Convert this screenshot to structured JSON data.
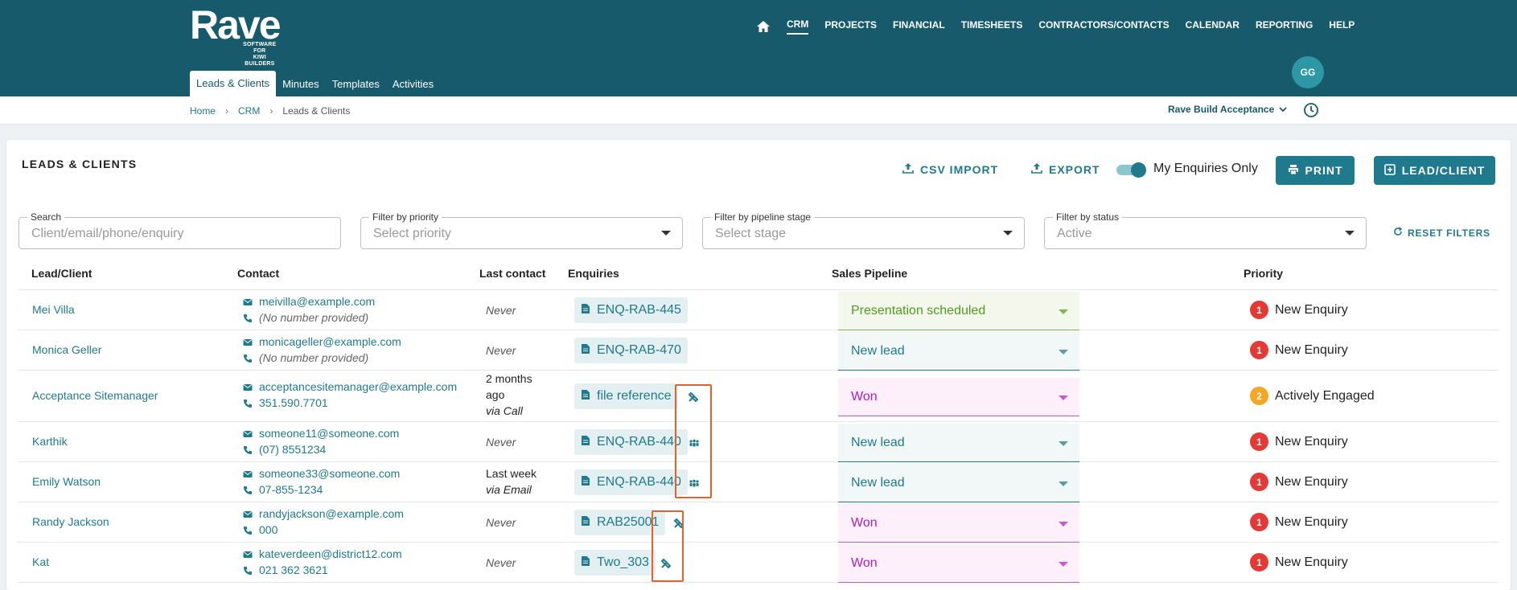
{
  "app": {
    "logo_text": "Rave",
    "logo_sub": "SOFTWARE FOR\nKIWI BUILDERS"
  },
  "main_nav": [
    "CRM",
    "PROJECTS",
    "FINANCIAL",
    "TIMESHEETS",
    "CONTRACTORS/CONTACTS",
    "CALENDAR",
    "REPORTING",
    "HELP"
  ],
  "sub_nav": [
    "Leads & Clients",
    "Minutes",
    "Templates",
    "Activities"
  ],
  "user": {
    "initials": "GG"
  },
  "breadcrumb": {
    "home": "Home",
    "crm": "CRM",
    "current": "Leads & Clients"
  },
  "org_selector": "Rave Build Acceptance",
  "page": {
    "title": "LEADS & CLIENTS",
    "csv_import": "CSV IMPORT",
    "export": "EXPORT",
    "toggle_label": "My Enquiries Only",
    "print": "PRINT",
    "add_lead": "LEAD/CLIENT"
  },
  "filters": {
    "search_label": "Search",
    "search_placeholder": "Client/email/phone/enquiry",
    "priority_label": "Filter by priority",
    "priority_placeholder": "Select priority",
    "stage_label": "Filter by pipeline stage",
    "stage_placeholder": "Select stage",
    "status_label": "Filter by status",
    "status_value": "Active",
    "reset": "RESET FILTERS"
  },
  "table": {
    "headers": [
      "Lead/Client",
      "Contact",
      "Last contact",
      "Enquiries",
      "Sales Pipeline",
      "Priority"
    ],
    "rows": [
      {
        "client": "Mei Villa",
        "email": "meivilla@example.com",
        "phone": "(No number provided)",
        "last": "Never",
        "last_via": "",
        "enquiry": "ENQ-RAB-445",
        "pipeline": "Presentation scheduled",
        "priority_num": "1",
        "priority": "New Enquiry"
      },
      {
        "client": "Monica Geller",
        "email": "monicageller@example.com",
        "phone": "(No number provided)",
        "last": "Never",
        "last_via": "",
        "enquiry": "ENQ-RAB-470",
        "pipeline": "New lead",
        "priority_num": "1",
        "priority": "New Enquiry"
      },
      {
        "client": "Acceptance Sitemanager",
        "email": "acceptancesitemanager@example.com",
        "phone": "351.590.7701",
        "last": "2 months ago",
        "last_via": "via Call",
        "enquiry": "file reference",
        "pipeline": "Won",
        "priority_num": "2",
        "priority": "Actively Engaged"
      },
      {
        "client": "Karthik",
        "email": "someone11@someone.com",
        "phone": "(07) 8551234",
        "last": "Never",
        "last_via": "",
        "enquiry": "ENQ-RAB-440",
        "pipeline": "New lead",
        "priority_num": "1",
        "priority": "New Enquiry"
      },
      {
        "client": "Emily Watson",
        "email": "someone33@someone.com",
        "phone": "07-855-1234",
        "last": "Last week",
        "last_via": "via Email",
        "enquiry": "ENQ-RAB-440",
        "pipeline": "New lead",
        "priority_num": "1",
        "priority": "New Enquiry"
      },
      {
        "client": "Randy Jackson",
        "email": "randyjackson@example.com",
        "phone": "000",
        "last": "Never",
        "last_via": "",
        "enquiry": "RAB25001",
        "pipeline": "Won",
        "priority_num": "1",
        "priority": "New Enquiry"
      },
      {
        "client": "Kat",
        "email": "kateverdeen@district12.com",
        "phone": "021 362 3621",
        "last": "Never",
        "last_via": "",
        "enquiry": "Two_303",
        "pipeline": "Won",
        "priority_num": "1",
        "priority": "New Enquiry"
      }
    ]
  },
  "colors": {
    "header_bg": "#175a6c",
    "accent": "#1e7a8c",
    "priority_1": "#e53935",
    "priority_2": "#f5a623",
    "pipeline_won_text": "#b01bc4",
    "pipeline_presentation_text": "#4f9a1d",
    "highlight": "#e2622a"
  }
}
